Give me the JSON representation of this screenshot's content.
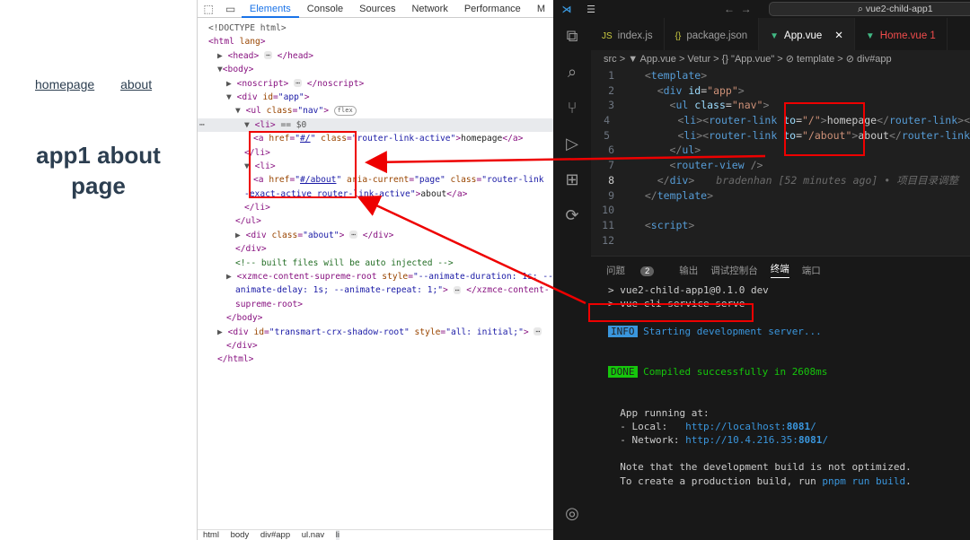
{
  "page": {
    "nav": [
      "homepage",
      "about"
    ],
    "title_line1": "app1 about",
    "title_line2": "page"
  },
  "devtools": {
    "tabs": [
      "Elements",
      "Console",
      "Sources",
      "Network",
      "Performance",
      "M"
    ],
    "active_tab": "Elements",
    "dom_lines": [
      {
        "indent": 0,
        "html": "<span class='g'>&lt;!DOCTYPE html&gt;</span>"
      },
      {
        "indent": 0,
        "html": "<span class='t'>&lt;html</span> <span class='a'>lang</span><span class='t'>&gt;</span>"
      },
      {
        "indent": 1,
        "html": "<span class='g'>▶</span> <span class='t'>&lt;head&gt;</span> <span class='ell'>⋯</span> <span class='t'>&lt;/head&gt;</span>"
      },
      {
        "indent": 1,
        "html": "<span class='g'>▼</span><span class='t'>&lt;body&gt;</span>"
      },
      {
        "indent": 2,
        "html": "<span class='g'>▶</span> <span class='t'>&lt;noscript&gt;</span> <span class='ell'>⋯</span> <span class='t'>&lt;/noscript&gt;</span>"
      },
      {
        "indent": 2,
        "html": "<span class='g'>▼</span> <span class='t'>&lt;div</span> <span class='a'>id</span>=<span class='v'>\"app\"</span><span class='t'>&gt;</span>"
      },
      {
        "indent": 3,
        "html": "<span class='g'>▼</span> <span class='t'>&lt;ul</span> <span class='a'>class</span>=<span class='v'>\"nav\"</span><span class='t'>&gt;</span> <span class='flexbadge'>flex</span>"
      },
      {
        "indent": 4,
        "sel": true,
        "html": "<span class='g'>▼</span> <span class='t'>&lt;li&gt;</span> <span class='g'>== $0</span>"
      },
      {
        "indent": 5,
        "html": "<span class='t'>&lt;a</span> <span class='a'>href</span>=<span class='v'>\"<u>#/</u>\"</span> <span class='a'>class</span>=<span class='v'>\"router-link-active\"</span><span class='t'>&gt;</span><span class='tx'>homepage</span><span class='t'>&lt;/a&gt;</span>"
      },
      {
        "indent": 4,
        "html": "<span class='t'>&lt;/li&gt;</span>"
      },
      {
        "indent": 4,
        "html": "<span class='g'>▼</span> <span class='t'>&lt;li&gt;</span>"
      },
      {
        "indent": 5,
        "html": "<span class='t'>&lt;a</span> <span class='a'>href</span>=<span class='v'>\"<u>#/about</u>\"</span> <span class='a'>aria-current</span>=<span class='v'>\"page\"</span> <span class='a'>class</span>=<span class='v'>\"router-link</span>"
      },
      {
        "indent": 4,
        "html": "<span class='v'>-exact-active router-link-active\"</span><span class='t'>&gt;</span><span class='tx'>about</span><span class='t'>&lt;/a&gt;</span>"
      },
      {
        "indent": 4,
        "html": "<span class='t'>&lt;/li&gt;</span>"
      },
      {
        "indent": 3,
        "html": "<span class='t'>&lt;/ul&gt;</span>"
      },
      {
        "indent": 3,
        "html": "<span class='g'>▶</span> <span class='t'>&lt;div</span> <span class='a'>class</span>=<span class='v'>\"about\"</span><span class='t'>&gt;</span> <span class='ell'>⋯</span> <span class='t'>&lt;/div&gt;</span>"
      },
      {
        "indent": 3,
        "html": "<span class='t'>&lt;/div&gt;</span>"
      },
      {
        "indent": 3,
        "html": "<span class='c'>&lt;!-- built files will be auto injected --&gt;</span>"
      },
      {
        "indent": 2,
        "html": "<span class='g'>▶</span> <span class='t'>&lt;xzmce-content-supreme-root</span> <span class='a'>style</span>=<span class='v'>\"--animate-duration: 1s; --</span>"
      },
      {
        "indent": 3,
        "html": "<span class='v'>animate-delay: 1s; --animate-repeat: 1;\"</span><span class='t'>&gt;</span> <span class='ell'>⋯</span> <span class='t'>&lt;/xzmce-content-</span>"
      },
      {
        "indent": 3,
        "html": "<span class='t'>supreme-root&gt;</span>"
      },
      {
        "indent": 2,
        "html": "<span class='t'>&lt;/body&gt;</span>"
      },
      {
        "indent": 1,
        "html": "<span class='g'>▶</span> <span class='t'>&lt;div</span> <span class='a'>id</span>=<span class='v'>\"transmart-crx-shadow-root\"</span> <span class='a'>style</span>=<span class='v'>\"all: initial;\"</span><span class='t'>&gt;</span> <span class='ell'>⋯</span>"
      },
      {
        "indent": 2,
        "html": "<span class='t'>&lt;/div&gt;</span>"
      },
      {
        "indent": 1,
        "html": "<span class='t'>&lt;/html&gt;</span>"
      }
    ],
    "breadcrumbs": [
      "html",
      "body",
      "div#app",
      "ul.nav",
      "li"
    ]
  },
  "vscode": {
    "search": "vue2-child-app1",
    "tabs": [
      {
        "icon": "JS",
        "label": "index.js",
        "color": "#cbcb41"
      },
      {
        "icon": "{}",
        "label": "package.json",
        "color": "#cbcb41"
      },
      {
        "icon": "▼",
        "label": "App.vue",
        "color": "#41b883",
        "active": true,
        "close": "✕"
      },
      {
        "icon": "▼",
        "label": "Home.vue 1",
        "color": "#41b883",
        "labelColor": "#f14c4c"
      }
    ],
    "breadcrumb": "src > ▼ App.vue > Vetur > {} \"App.vue\" > ⊘ template > ⊘ div#app",
    "code": [
      {
        "n": "1",
        "html": "  <span class='p'>&lt;</span><span class='k'>template</span><span class='p'>&gt;</span>"
      },
      {
        "n": "2",
        "html": "    <span class='p'>&lt;</span><span class='k'>div</span> <span class='at'>id</span>=<span class='s'>\"app\"</span><span class='p'>&gt;</span>"
      },
      {
        "n": "3",
        "html": "      <span class='p'>&lt;</span><span class='k'>ul</span> <span class='at'>class</span>=<span class='s'>\"nav\"</span><span class='p'>&gt;</span>"
      },
      {
        "n": "4",
        "html": "        <span class='p'>&lt;</span><span class='k'>li</span><span class='p'>&gt;&lt;</span><span class='k'>router-link</span> <span class='at'>to</span>=<span class='s'>\"/\"</span><span class='p'>&gt;</span>homepage<span class='p'>&lt;/</span><span class='k'>router-link</span><span class='p'>&gt;&lt;</span>"
      },
      {
        "n": "5",
        "html": "        <span class='p'>&lt;</span><span class='k'>li</span><span class='p'>&gt;&lt;</span><span class='k'>router-link</span> <span class='at'>to</span>=<span class='s'>\"/about\"</span><span class='p'>&gt;</span>about<span class='p'>&lt;/</span><span class='k'>router-link</span>"
      },
      {
        "n": "6",
        "html": "      <span class='p'>&lt;/</span><span class='k'>ul</span><span class='p'>&gt;</span>"
      },
      {
        "n": "7",
        "html": "      <span class='p'>&lt;</span><span class='k'>router-view</span> <span class='p'>/&gt;</span>"
      },
      {
        "n": "8",
        "cur": true,
        "html": "    <span class='p'>&lt;/</span><span class='k'>div</span><span class='p'>&gt;</span><span class='blame'>bradenhan [52 minutes ago] • 项目目录调整</span>"
      },
      {
        "n": "9",
        "html": "  <span class='p'>&lt;/</span><span class='k'>template</span><span class='p'>&gt;</span>"
      },
      {
        "n": "10",
        "html": ""
      },
      {
        "n": "11",
        "html": "  <span class='p'>&lt;</span><span class='k'>script</span><span class='p'>&gt;</span>"
      },
      {
        "n": "12",
        "html": ""
      }
    ],
    "panel_tabs": [
      "问题",
      "输出",
      "调试控制台",
      "终端",
      "端口"
    ],
    "problems_count": "2",
    "active_panel_tab": "终端",
    "terminal": [
      {
        "html": "&gt; vue2-child-app1@0.1.0 dev"
      },
      {
        "html": "&gt; vue-cli-service serve"
      },
      {
        "html": ""
      },
      {
        "html": "<span class='info'>INFO</span> <span class='infotext'>Starting development server...</span>"
      },
      {
        "html": ""
      },
      {
        "html": ""
      },
      {
        "html": "<span class='done'>DONE</span> <span class='donetext'>Compiled successfully in 2608ms</span>"
      },
      {
        "html": ""
      },
      {
        "html": ""
      },
      {
        "html": "  App running at:"
      },
      {
        "html": "  - Local:   <span class='url'>http://localhost:<b>8081</b>/</span>"
      },
      {
        "html": "  - Network: <span class='url'>http://10.4.216.35:<b>8081</b>/</span>"
      },
      {
        "html": ""
      },
      {
        "html": "  Note that the development build is not optimized."
      },
      {
        "html": "  To create a production build, run <span class='cmd'>pnpm run build</span>."
      }
    ]
  }
}
